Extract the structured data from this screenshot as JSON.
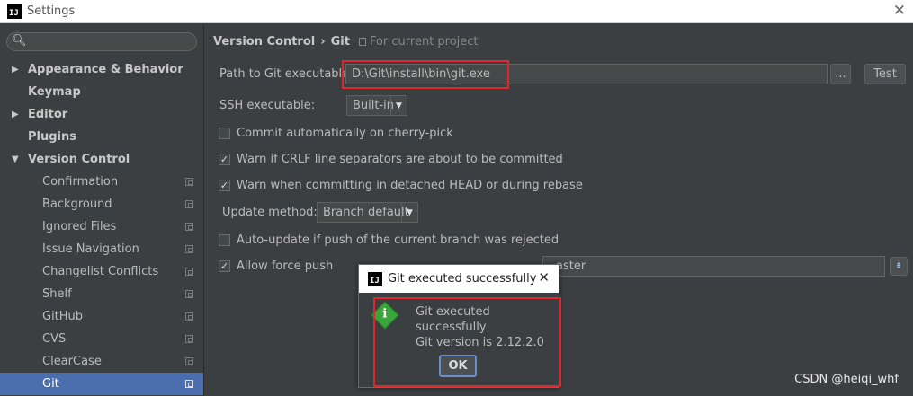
{
  "window": {
    "title": "Settings",
    "app_icon": "IJ"
  },
  "sidebar": {
    "items": [
      {
        "label": "Appearance & Behavior",
        "level": 0,
        "arrow": "▶"
      },
      {
        "label": "Keymap",
        "level": 0,
        "arrow": ""
      },
      {
        "label": "Editor",
        "level": 0,
        "arrow": "▶"
      },
      {
        "label": "Plugins",
        "level": 0,
        "arrow": ""
      },
      {
        "label": "Version Control",
        "level": 0,
        "arrow": "▼"
      },
      {
        "label": "Confirmation",
        "level": 1
      },
      {
        "label": "Background",
        "level": 1
      },
      {
        "label": "Ignored Files",
        "level": 1
      },
      {
        "label": "Issue Navigation",
        "level": 1
      },
      {
        "label": "Changelist Conflicts",
        "level": 1
      },
      {
        "label": "Shelf",
        "level": 1
      },
      {
        "label": "GitHub",
        "level": 1
      },
      {
        "label": "CVS",
        "level": 1
      },
      {
        "label": "ClearCase",
        "level": 1
      },
      {
        "label": "Git",
        "level": 1,
        "selected": true
      }
    ]
  },
  "breadcrumb": {
    "part1": "Version Control",
    "sep": "›",
    "part2": "Git",
    "project": "For current project"
  },
  "git_path": {
    "label": "Path to Git executable:",
    "value": "D:\\Git\\install\\bin\\git.exe",
    "browse": "...",
    "test": "Test"
  },
  "ssh": {
    "label": "SSH executable:",
    "value": "Built-in"
  },
  "options": {
    "cherry_pick": {
      "label": "Commit automatically on cherry-pick",
      "checked": false
    },
    "crlf": {
      "label": "Warn if CRLF line separators are about to be committed",
      "checked": true
    },
    "detached": {
      "label": "Warn when committing in detached HEAD or during rebase",
      "checked": true
    },
    "update_method_label": "Update method:",
    "update_method_value": "Branch default",
    "auto_update": {
      "label": "Auto-update if push of the current branch was rejected",
      "checked": false
    },
    "force_push": {
      "label": "Allow force push",
      "checked": true
    },
    "protected_value": "aster"
  },
  "dialog": {
    "title": "Git executed successfully",
    "line1": "Git executed successfully",
    "line2": "Git version is 2.12.2.0",
    "ok": "OK"
  },
  "watermark": "CSDN @heiqi_whf",
  "colors": {
    "accent": "#4b6eaf",
    "highlight": "#e0282a",
    "background": "#3c3f41"
  }
}
